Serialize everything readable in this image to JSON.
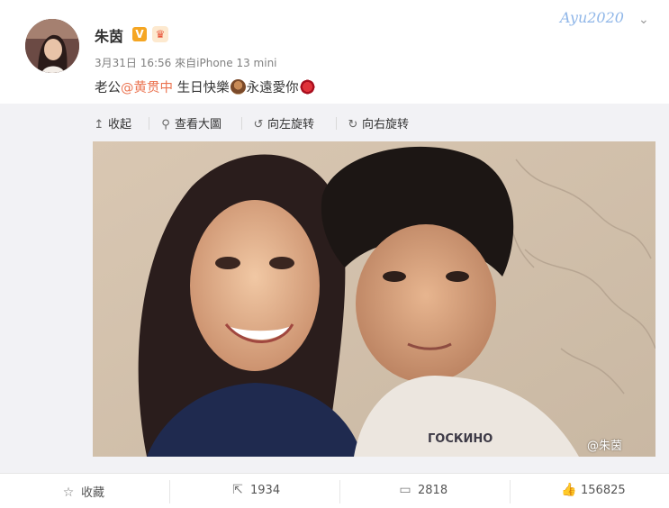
{
  "post": {
    "author_name": "朱茵",
    "timestamp": "3月31日 16:56",
    "source": "來自iPhone 13 mini",
    "watermark_text": "Ayu2020",
    "content": {
      "prefix": "老公",
      "mention": "@黄贯中",
      "middle": " 生日快樂",
      "after_cake": "永遠愛你"
    },
    "emojis": [
      "cake-emoji",
      "lips-emoji"
    ]
  },
  "toolbar": {
    "collapse": "收起",
    "view_large": "查看大圖",
    "rotate_left": "向左旋转",
    "rotate_right": "向右旋转"
  },
  "photo": {
    "watermark": "@朱茵",
    "shirt_text": "ГОСКИНО"
  },
  "footer": {
    "favorite": "收藏",
    "repost_count": "1934",
    "comment_count": "2818",
    "like_count": "156825"
  },
  "icons": {
    "collapse": "arrow-up-icon",
    "view_large": "search-icon",
    "rotate_left": "rotate-left-icon",
    "rotate_right": "rotate-right-icon",
    "favorite": "star-icon",
    "repost": "share-icon",
    "comment": "comment-icon",
    "like": "thumbs-up-icon"
  },
  "colors": {
    "mention": "#eb7350",
    "verified_badge": "#f5a623",
    "expand_bg": "#f2f2f5"
  }
}
